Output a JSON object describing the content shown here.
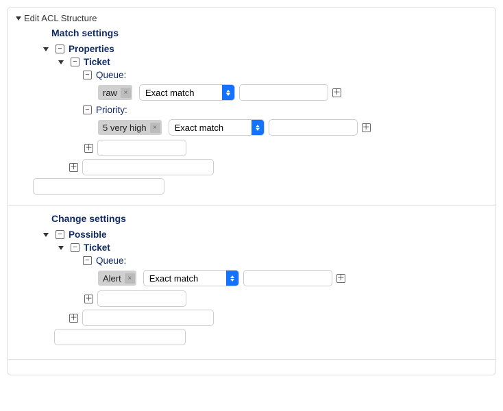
{
  "panel": {
    "title": "Edit ACL Structure"
  },
  "match": {
    "title": "Match settings",
    "properties_label": "Properties",
    "ticket_label": "Ticket",
    "queue": {
      "label": "Queue:",
      "tag": "raw",
      "match_type": "Exact match",
      "value": ""
    },
    "priority": {
      "label": "Priority:",
      "tag": "5 very high",
      "match_type": "Exact match",
      "value": ""
    }
  },
  "change": {
    "title": "Change settings",
    "possible_label": "Possible",
    "ticket_label": "Ticket",
    "queue": {
      "label": "Queue:",
      "tag": "Alert",
      "match_type": "Exact match",
      "value": ""
    }
  },
  "select_options": [
    "Exact match"
  ]
}
